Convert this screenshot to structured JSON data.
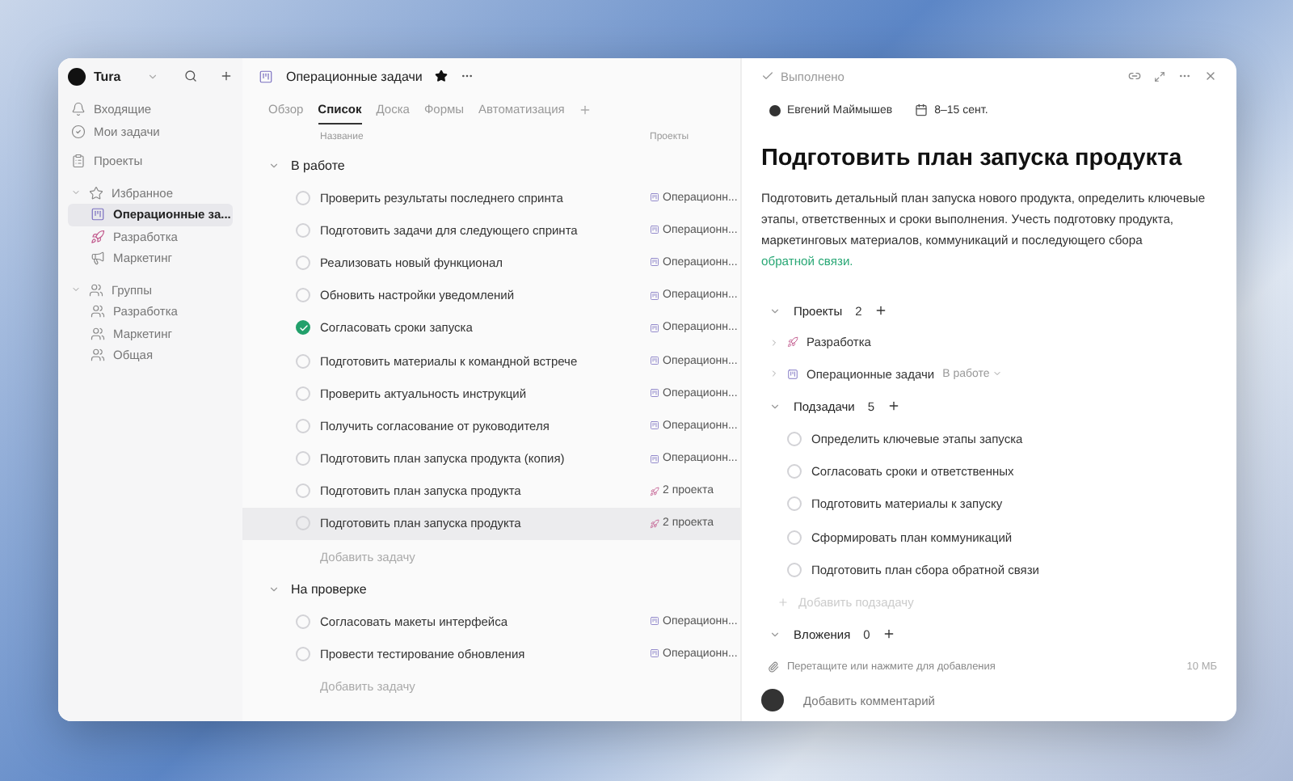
{
  "sidebar": {
    "workspace": "Tura",
    "nav": [
      {
        "label": "Входящие",
        "kind": "bell"
      },
      {
        "label": "Мои задачи",
        "kind": "check-circle"
      },
      {
        "label": "Проекты",
        "kind": "clipboard"
      }
    ],
    "sections": [
      {
        "label": "Избранное",
        "kind": "star",
        "expanded": true,
        "children": [
          {
            "label": "Операционные за...",
            "kind": "board",
            "selected": true
          },
          {
            "label": "Разработка",
            "kind": "rocket",
            "selected": false
          },
          {
            "label": "Маркетинг",
            "kind": "megaphone",
            "selected": false
          }
        ]
      },
      {
        "label": "Группы",
        "kind": "users",
        "expanded": true,
        "children": [
          {
            "label": "Разработка",
            "kind": "users",
            "selected": false
          },
          {
            "label": "Маркетинг",
            "kind": "users",
            "selected": false
          },
          {
            "label": "Общая",
            "kind": "users",
            "selected": false
          }
        ]
      }
    ]
  },
  "list": {
    "title": "Операционные задачи",
    "starred": true,
    "tabs": [
      {
        "label": "Обзор",
        "selected": false
      },
      {
        "label": "Список",
        "selected": true
      },
      {
        "label": "Доска",
        "selected": false
      },
      {
        "label": "Формы",
        "selected": false
      },
      {
        "label": "Автоматизация",
        "selected": false
      }
    ],
    "columns": [
      "Название",
      "Проекты"
    ],
    "groups": [
      {
        "label": "В работе",
        "expanded": true,
        "add_label": "Добавить задачу",
        "tasks": [
          {
            "title": "Проверить результаты последнего спринта",
            "done": false,
            "selected": false,
            "project": {
              "label": "Операционн...",
              "kind": "board"
            }
          },
          {
            "title": "Подготовить задачи для следующего спринта",
            "done": false,
            "selected": false,
            "project": {
              "label": "Операционн...",
              "kind": "board"
            }
          },
          {
            "title": "Реализовать новый функционал",
            "done": false,
            "selected": false,
            "project": {
              "label": "Операционн...",
              "kind": "board"
            }
          },
          {
            "title": "Обновить настройки уведомлений",
            "done": false,
            "selected": false,
            "project": {
              "label": "Операционн...",
              "kind": "board"
            }
          },
          {
            "title": "Согласовать сроки запуска",
            "done": true,
            "selected": false,
            "project": {
              "label": "Операционн...",
              "kind": "board"
            }
          },
          {
            "title": "Подготовить материалы к командной встрече",
            "done": false,
            "selected": false,
            "project": {
              "label": "Операционн...",
              "kind": "board"
            }
          },
          {
            "title": "Проверить актуальность инструкций",
            "done": false,
            "selected": false,
            "project": {
              "label": "Операционн...",
              "kind": "board"
            }
          },
          {
            "title": "Получить согласование от руководителя",
            "done": false,
            "selected": false,
            "project": {
              "label": "Операционн...",
              "kind": "board"
            }
          },
          {
            "title": "Подготовить план запуска продукта (копия)",
            "done": false,
            "selected": false,
            "project": {
              "label": "Операционн...",
              "kind": "board"
            }
          },
          {
            "title": "Подготовить план запуска продукта",
            "done": false,
            "selected": false,
            "project": {
              "label": "2 проекта",
              "kind": "rocket"
            }
          },
          {
            "title": "Подготовить план запуска продукта",
            "done": false,
            "selected": true,
            "project": {
              "label": "2 проекта",
              "kind": "rocket"
            }
          }
        ]
      },
      {
        "label": "На проверке",
        "expanded": true,
        "add_label": "Добавить задачу",
        "tasks": [
          {
            "title": "Согласовать макеты интерфейса",
            "done": false,
            "selected": false,
            "project": {
              "label": "Операционн...",
              "kind": "board"
            }
          },
          {
            "title": "Провести тестирование обновления",
            "done": false,
            "selected": false,
            "project": {
              "label": "Операционн...",
              "kind": "board"
            }
          }
        ]
      }
    ]
  },
  "detail": {
    "complete_label": "Выполнено",
    "assignee": "Евгений Маймышев",
    "dates": "8–15 сент.",
    "title": "Подготовить план запуска продукта",
    "description": "Подготовить детальный план запуска нового продукта, определить ключевые этапы, ответственных и сроки выполнения. Учесть подготовку продукта, маркетинговых материалов, коммуникаций и последующего сбора ",
    "description_link": "обратной связи.",
    "projects": {
      "label": "Проекты",
      "count": "2",
      "expanded": true,
      "items": [
        {
          "name": "Разработка",
          "kind": "rocket"
        },
        {
          "name": "Операционные задачи",
          "kind": "board",
          "status": "В работе"
        }
      ]
    },
    "subtasks": {
      "label": "Подзадачи",
      "count": "5",
      "expanded": true,
      "add_label": "Добавить подзадачу",
      "items": [
        {
          "title": "Определить ключевые этапы запуска",
          "done": false
        },
        {
          "title": "Согласовать сроки и ответственных",
          "done": false
        },
        {
          "title": "Подготовить материалы к запуску",
          "done": false
        },
        {
          "title": "Сформировать план коммуникаций",
          "done": false
        },
        {
          "title": "Подготовить план сбора обратной связи",
          "done": false
        }
      ]
    },
    "attachments": {
      "label": "Вложения",
      "count": "0",
      "expanded": true,
      "hint": "Перетащите или нажмите для добавления",
      "limit": "10 МБ"
    },
    "comment": {
      "placeholder": "Добавить комментарий"
    }
  }
}
